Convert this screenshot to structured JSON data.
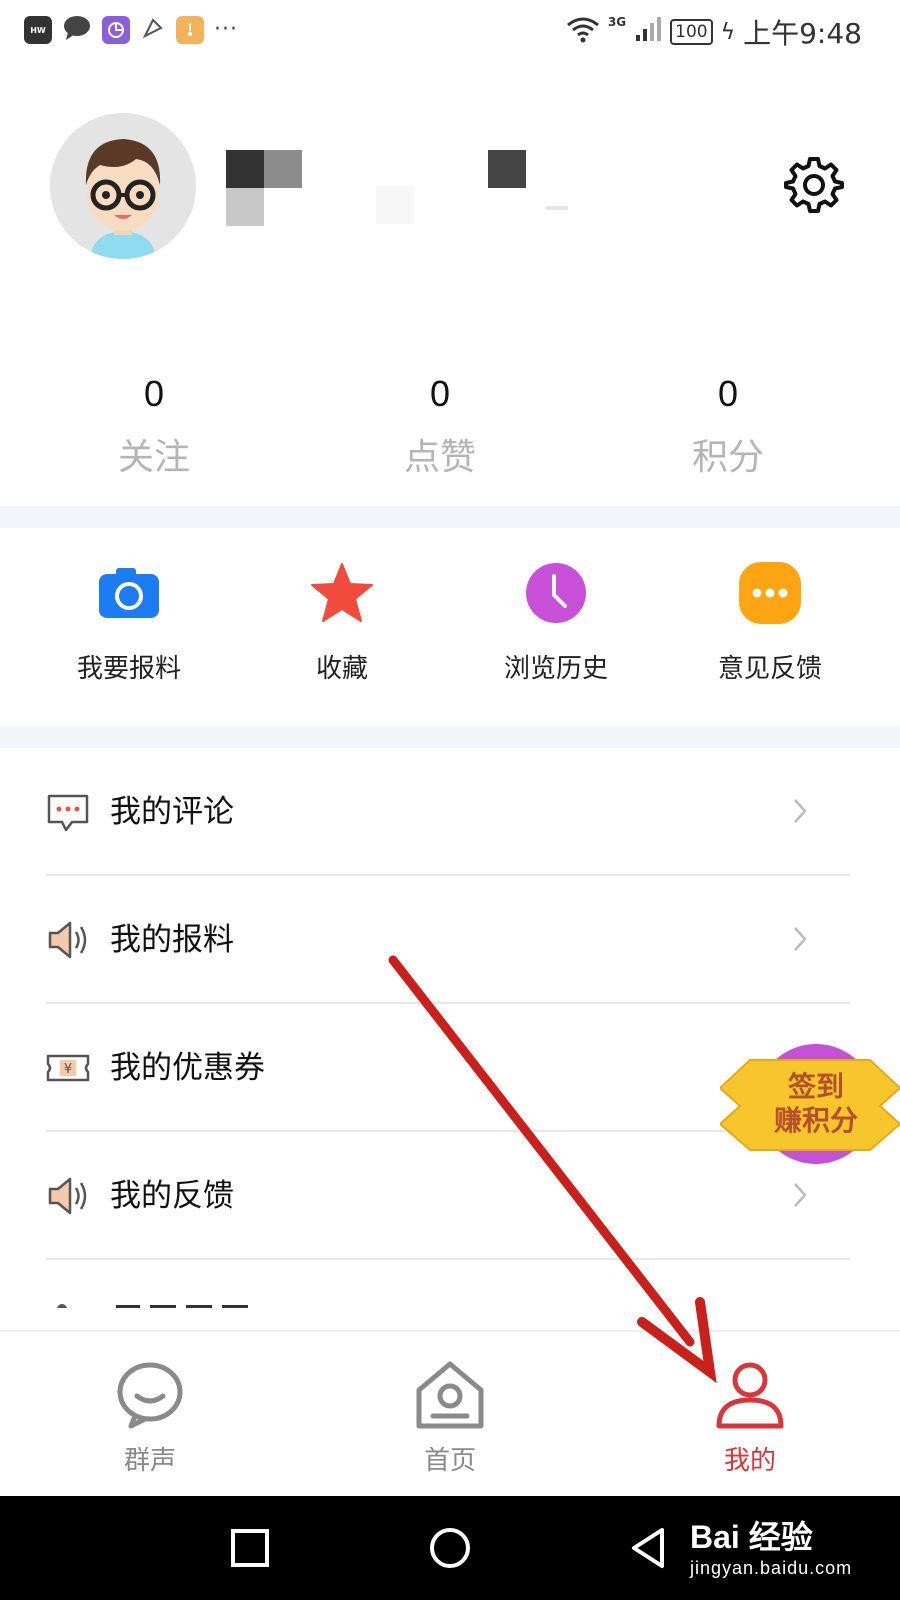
{
  "status_bar": {
    "network": "3G",
    "battery": "100",
    "time": "上午9:48",
    "more": "···"
  },
  "profile": {
    "stats": [
      {
        "value": "0",
        "label": "关注"
      },
      {
        "value": "0",
        "label": "点赞"
      },
      {
        "value": "0",
        "label": "积分"
      }
    ]
  },
  "quick_actions": [
    {
      "label": "我要报料",
      "icon": "camera-icon",
      "color": "#1e7cf2"
    },
    {
      "label": "收藏",
      "icon": "star-icon",
      "color": "#f04b3c"
    },
    {
      "label": "浏览历史",
      "icon": "clock-icon",
      "color": "#c84fd8"
    },
    {
      "label": "意见反馈",
      "icon": "more-dots-icon",
      "color": "#ffa513"
    }
  ],
  "menu": [
    {
      "label": "我的评论",
      "icon": "comment-icon"
    },
    {
      "label": "我的报料",
      "icon": "speaker-icon"
    },
    {
      "label": "我的优惠券",
      "icon": "coupon-icon"
    },
    {
      "label": "我的反馈",
      "icon": "speaker-icon"
    }
  ],
  "signin_badge": {
    "line1": "签到",
    "line2": "赚积分"
  },
  "bottom_nav": [
    {
      "label": "群声",
      "icon": "chat-bubble-icon",
      "active": false
    },
    {
      "label": "首页",
      "icon": "home-icon",
      "active": false
    },
    {
      "label": "我的",
      "icon": "person-icon",
      "active": true
    }
  ],
  "watermark": {
    "main": "Bai  经验",
    "sub": "jingyan.baidu.com"
  },
  "colors": {
    "accent": "#d9353a",
    "muted": "#b5b5b5",
    "band": "#f4f5fa",
    "arrow": "#c8201a"
  }
}
